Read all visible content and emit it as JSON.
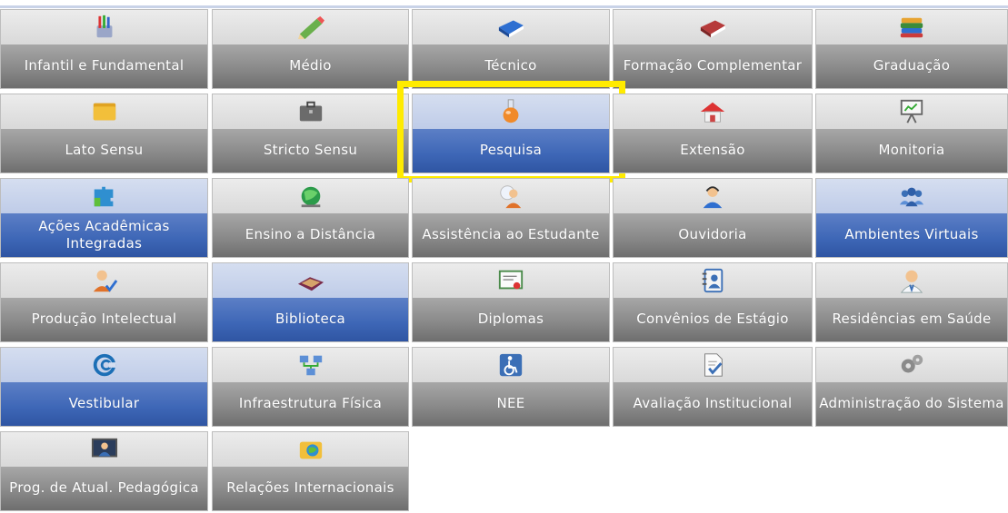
{
  "colors": {
    "tile_gray": "#8a8a8a",
    "tile_blue": "#3d66b6",
    "highlight": "#ffeb00",
    "label_text": "#ffffff"
  },
  "tiles": [
    {
      "label": "Infantil e Fundamental",
      "icon": "crayons-icon"
    },
    {
      "label": "Médio",
      "icon": "pencil-icon"
    },
    {
      "label": "Técnico",
      "icon": "blue-book-icon"
    },
    {
      "label": "Formação Complementar",
      "icon": "red-book-icon"
    },
    {
      "label": "Graduação",
      "icon": "book-stack-icon"
    },
    {
      "label": "Lato Sensu",
      "icon": "folder-icon"
    },
    {
      "label": "Stricto Sensu",
      "icon": "briefcase-icon"
    },
    {
      "label": "Pesquisa",
      "icon": "flask-icon"
    },
    {
      "label": "Extensão",
      "icon": "house-icon"
    },
    {
      "label": "Monitoria",
      "icon": "presentation-icon"
    },
    {
      "label": "Ações Acadêmicas Integradas",
      "icon": "puzzle-icon"
    },
    {
      "label": "Ensino a Distância",
      "icon": "globe-icon"
    },
    {
      "label": "Assistência ao Estudante",
      "icon": "user-help-icon"
    },
    {
      "label": "Ouvidoria",
      "icon": "headset-user-icon"
    },
    {
      "label": "Ambientes Virtuais",
      "icon": "users-group-icon"
    },
    {
      "label": "Produção Intelectual",
      "icon": "user-check-icon"
    },
    {
      "label": "Biblioteca",
      "icon": "open-book-icon"
    },
    {
      "label": "Diplomas",
      "icon": "certificate-icon"
    },
    {
      "label": "Convênios de Estágio",
      "icon": "address-book-icon"
    },
    {
      "label": "Residências em Saúde",
      "icon": "doctor-icon"
    },
    {
      "label": "Vestibular",
      "icon": "vestibular-logo-icon"
    },
    {
      "label": "Infraestrutura Física",
      "icon": "network-icon"
    },
    {
      "label": "NEE",
      "icon": "wheelchair-icon"
    },
    {
      "label": "Avaliação Institucional",
      "icon": "document-check-icon"
    },
    {
      "label": "Administração do Sistema",
      "icon": "gears-icon"
    },
    {
      "label": "Prog. de Atual. Pedagógica",
      "icon": "monitor-user-icon"
    },
    {
      "label": "Relações Internacionais",
      "icon": "world-folder-icon"
    }
  ],
  "selected": [
    "Pesquisa",
    "Ações Acadêmicas Integradas",
    "Ambientes Virtuais",
    "Biblioteca",
    "Vestibular"
  ],
  "highlighted": "Pesquisa"
}
